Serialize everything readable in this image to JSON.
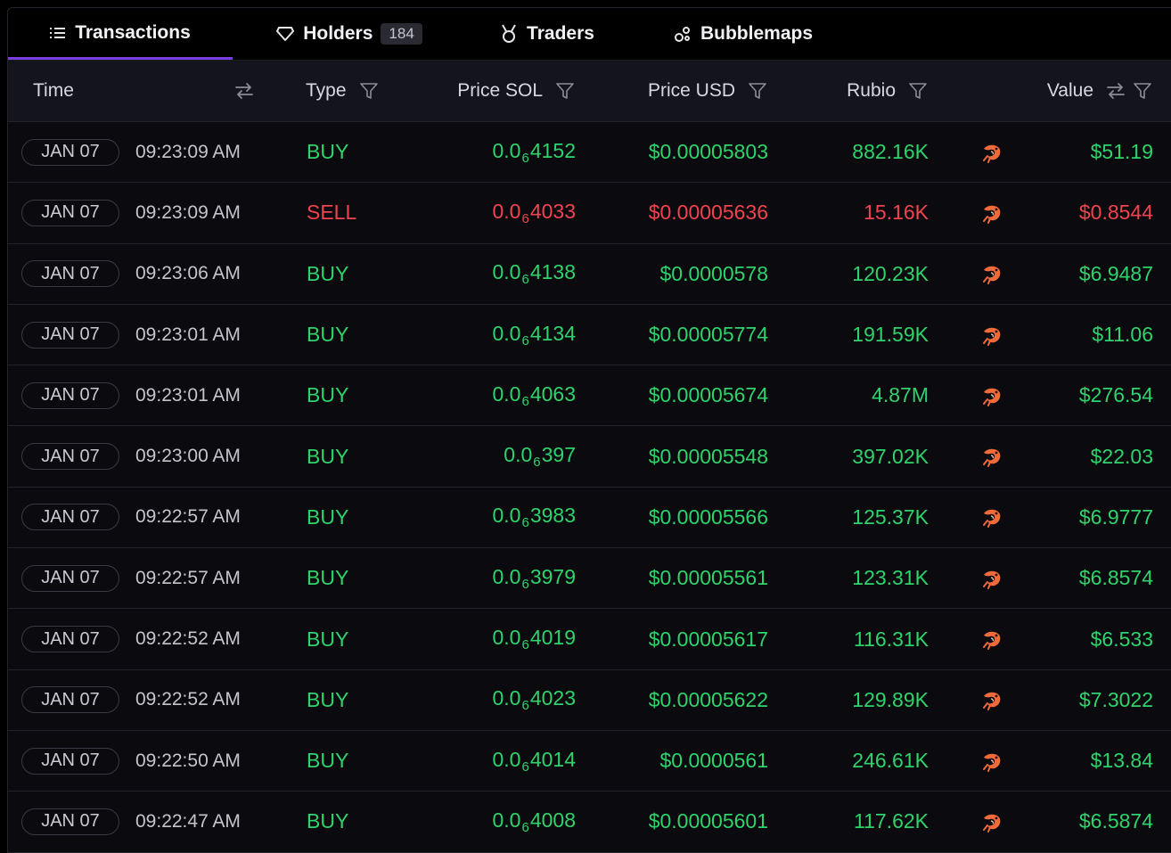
{
  "tabs": [
    {
      "label": "Transactions",
      "icon": "list-icon",
      "active": true
    },
    {
      "label": "Holders",
      "icon": "heart-outline-icon",
      "badge": "184",
      "active": false
    },
    {
      "label": "Traders",
      "icon": "medal-icon",
      "active": false
    },
    {
      "label": "Bubblemaps",
      "icon": "bubbles-icon",
      "active": false
    }
  ],
  "columns": {
    "time": "Time",
    "type": "Type",
    "price_sol": "Price SOL",
    "price_usd": "Price USD",
    "token": "Rubio",
    "value": "Value"
  },
  "colors": {
    "buy": "#2fd36b",
    "sell": "#f0434f",
    "tab_active_underline": "#7b3fe4",
    "header_bg": "#14141c",
    "maker_icon": "#f06a3a"
  },
  "rows": [
    {
      "date": "JAN 07",
      "time": "09:23:09 AM",
      "type": "BUY",
      "sol_prefix": "0.0",
      "sol_zeros": "6",
      "sol_digits": "4152",
      "usd": "$0.00005803",
      "amount": "882.16K",
      "value": "$51.19"
    },
    {
      "date": "JAN 07",
      "time": "09:23:09 AM",
      "type": "SELL",
      "sol_prefix": "0.0",
      "sol_zeros": "6",
      "sol_digits": "4033",
      "usd": "$0.00005636",
      "amount": "15.16K",
      "value": "$0.8544"
    },
    {
      "date": "JAN 07",
      "time": "09:23:06 AM",
      "type": "BUY",
      "sol_prefix": "0.0",
      "sol_zeros": "6",
      "sol_digits": "4138",
      "usd": "$0.0000578",
      "amount": "120.23K",
      "value": "$6.9487"
    },
    {
      "date": "JAN 07",
      "time": "09:23:01 AM",
      "type": "BUY",
      "sol_prefix": "0.0",
      "sol_zeros": "6",
      "sol_digits": "4134",
      "usd": "$0.00005774",
      "amount": "191.59K",
      "value": "$11.06"
    },
    {
      "date": "JAN 07",
      "time": "09:23:01 AM",
      "type": "BUY",
      "sol_prefix": "0.0",
      "sol_zeros": "6",
      "sol_digits": "4063",
      "usd": "$0.00005674",
      "amount": "4.87M",
      "value": "$276.54"
    },
    {
      "date": "JAN 07",
      "time": "09:23:00 AM",
      "type": "BUY",
      "sol_prefix": "0.0",
      "sol_zeros": "6",
      "sol_digits": "397",
      "usd": "$0.00005548",
      "amount": "397.02K",
      "value": "$22.03"
    },
    {
      "date": "JAN 07",
      "time": "09:22:57 AM",
      "type": "BUY",
      "sol_prefix": "0.0",
      "sol_zeros": "6",
      "sol_digits": "3983",
      "usd": "$0.00005566",
      "amount": "125.37K",
      "value": "$6.9777"
    },
    {
      "date": "JAN 07",
      "time": "09:22:57 AM",
      "type": "BUY",
      "sol_prefix": "0.0",
      "sol_zeros": "6",
      "sol_digits": "3979",
      "usd": "$0.00005561",
      "amount": "123.31K",
      "value": "$6.8574"
    },
    {
      "date": "JAN 07",
      "time": "09:22:52 AM",
      "type": "BUY",
      "sol_prefix": "0.0",
      "sol_zeros": "6",
      "sol_digits": "4019",
      "usd": "$0.00005617",
      "amount": "116.31K",
      "value": "$6.533"
    },
    {
      "date": "JAN 07",
      "time": "09:22:52 AM",
      "type": "BUY",
      "sol_prefix": "0.0",
      "sol_zeros": "6",
      "sol_digits": "4023",
      "usd": "$0.00005622",
      "amount": "129.89K",
      "value": "$7.3022"
    },
    {
      "date": "JAN 07",
      "time": "09:22:50 AM",
      "type": "BUY",
      "sol_prefix": "0.0",
      "sol_zeros": "6",
      "sol_digits": "4014",
      "usd": "$0.0000561",
      "amount": "246.61K",
      "value": "$13.84"
    },
    {
      "date": "JAN 07",
      "time": "09:22:47 AM",
      "type": "BUY",
      "sol_prefix": "0.0",
      "sol_zeros": "6",
      "sol_digits": "4008",
      "usd": "$0.00005601",
      "amount": "117.62K",
      "value": "$6.5874"
    }
  ]
}
